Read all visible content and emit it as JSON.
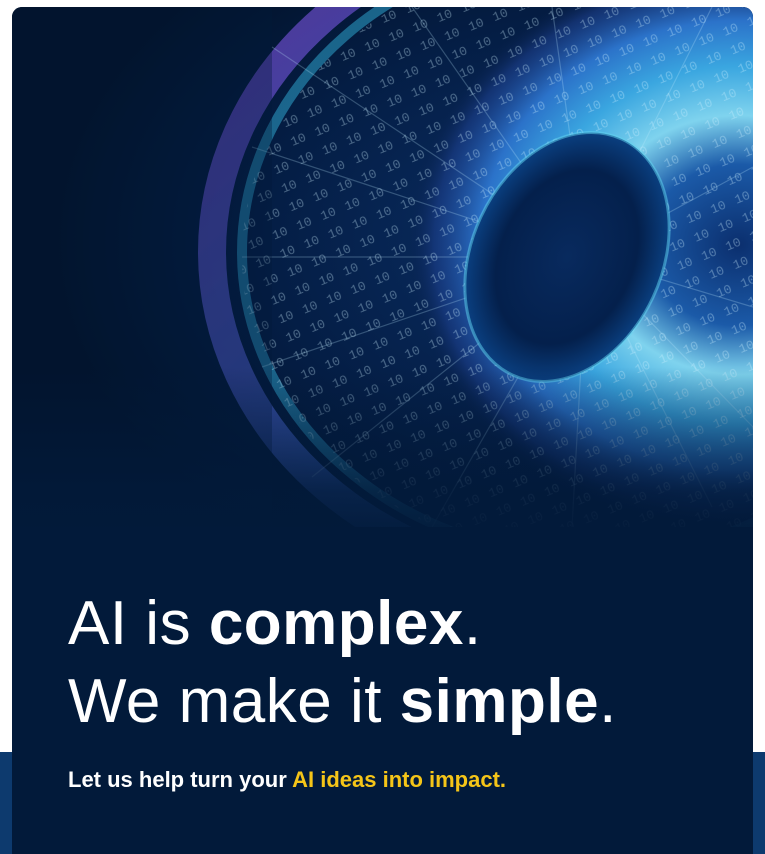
{
  "hero": {
    "image": "digital-eye-binary-iris",
    "colors": {
      "background": "#021a3a",
      "iris_cyan": "#3cc6e8",
      "iris_violet": "#7a4cd8",
      "pupil": "#041c44",
      "bottom_band": "#0d3a6e"
    }
  },
  "headline": {
    "line1_prefix": "AI is ",
    "line1_bold": "complex",
    "line1_suffix": ".",
    "line2_prefix": "We make it ",
    "line2_bold": "simple",
    "line2_suffix": "."
  },
  "subline": {
    "prefix": "Let us help turn your ",
    "accent": "AI ideas into impact.",
    "accent_color": "#f5c518"
  }
}
